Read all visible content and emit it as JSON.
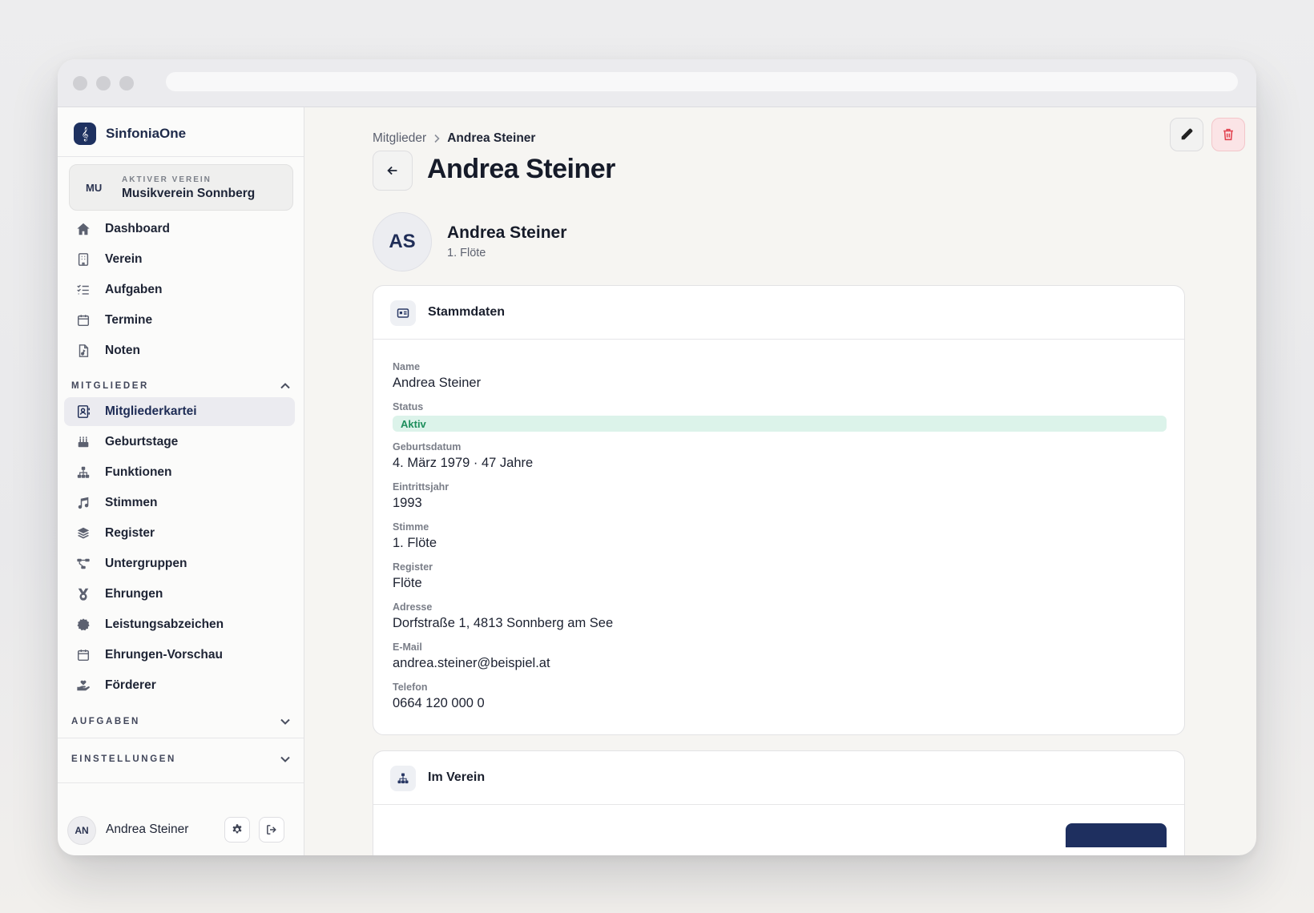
{
  "app": {
    "name": "SinfoniaOne"
  },
  "club": {
    "abbr": "MU",
    "caption": "AKTIVER VEREIN",
    "name": "Musikverein Sonnberg"
  },
  "nav_main": [
    {
      "label": "Dashboard",
      "icon": "home-icon"
    },
    {
      "label": "Verein",
      "icon": "building-icon"
    },
    {
      "label": "Aufgaben",
      "icon": "tasks-icon"
    },
    {
      "label": "Termine",
      "icon": "calendar-icon"
    },
    {
      "label": "Noten",
      "icon": "sheet-music-icon"
    }
  ],
  "section_members": {
    "title": "MITGLIEDER",
    "items": [
      {
        "label": "Mitgliederkartei",
        "icon": "contact-card-icon",
        "active": true
      },
      {
        "label": "Geburtstage",
        "icon": "cake-icon"
      },
      {
        "label": "Funktionen",
        "icon": "hierarchy-icon"
      },
      {
        "label": "Stimmen",
        "icon": "music-note-icon"
      },
      {
        "label": "Register",
        "icon": "layers-icon"
      },
      {
        "label": "Untergruppen",
        "icon": "diagram-icon"
      },
      {
        "label": "Ehrungen",
        "icon": "medal-icon"
      },
      {
        "label": "Leistungsabzeichen",
        "icon": "badge-icon"
      },
      {
        "label": "Ehrungen-Vorschau",
        "icon": "calendar-icon"
      },
      {
        "label": "Förderer",
        "icon": "hand-heart-icon"
      }
    ]
  },
  "section_tasks": {
    "title": "AUFGABEN"
  },
  "section_settings": {
    "title": "EINSTELLUNGEN"
  },
  "user": {
    "initials": "AN",
    "name": "Andrea Steiner"
  },
  "breadcrumb": {
    "parent": "Mitglieder",
    "current": "Andrea Steiner"
  },
  "page": {
    "title": "Andrea Steiner"
  },
  "profile": {
    "initials": "AS",
    "name": "Andrea Steiner",
    "subtitle": "1. Flöte"
  },
  "stammdaten": {
    "title": "Stammdaten",
    "fields": {
      "name": {
        "label": "Name",
        "value": "Andrea Steiner"
      },
      "status": {
        "label": "Status",
        "value": "Aktiv"
      },
      "birthdate": {
        "label": "Geburtsdatum",
        "value": "4. März 1979 · 47 Jahre"
      },
      "entry_year": {
        "label": "Eintrittsjahr",
        "value": "1993"
      },
      "voice": {
        "label": "Stimme",
        "value": "1. Flöte"
      },
      "register": {
        "label": "Register",
        "value": "Flöte"
      },
      "address": {
        "label": "Adresse",
        "value": "Dorfstraße 1, 4813 Sonnberg am See"
      },
      "email": {
        "label": "E-Mail",
        "value": "andrea.steiner@beispiel.at"
      },
      "phone": {
        "label": "Telefon",
        "value": "0664 120 000 0"
      }
    }
  },
  "im_verein": {
    "title": "Im Verein"
  },
  "colors": {
    "accent": "#1e2f5f",
    "danger": "#e2424f",
    "success": "#1d8e5c",
    "success_bg": "#dcf3ea"
  }
}
